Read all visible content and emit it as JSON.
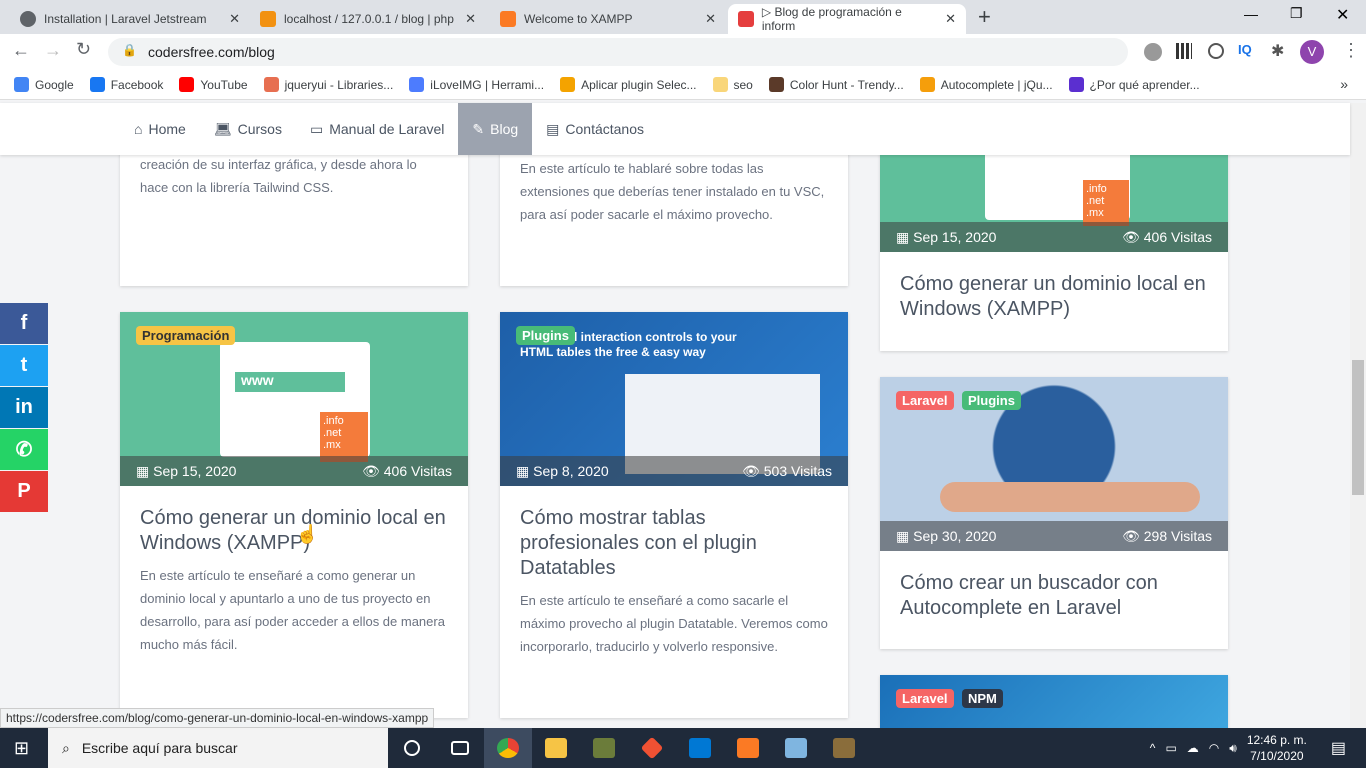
{
  "browser": {
    "tabs": [
      {
        "title": "Installation | Laravel Jetstream",
        "icon": "globe-icon",
        "color": "#5f6368"
      },
      {
        "title": "localhost / 127.0.0.1 / blog | php",
        "icon": "phpmyadmin-icon",
        "color": "#f29111"
      },
      {
        "title": "Welcome to XAMPP",
        "icon": "xampp-icon",
        "color": "#fb7a24"
      },
      {
        "title": "▷ Blog de programación e inform",
        "icon": "codersfree-icon",
        "color": "#e53e3e"
      }
    ],
    "new_tab": "+",
    "url": "codersfree.com/blog",
    "profile_initial": "V",
    "bookmarks": [
      {
        "label": "Google",
        "color": "#4285f4"
      },
      {
        "label": "Facebook",
        "color": "#1877f2"
      },
      {
        "label": "YouTube",
        "color": "#ff0000"
      },
      {
        "label": "jqueryui - Libraries...",
        "color": "#e76f51"
      },
      {
        "label": "iLoveIMG | Herrami...",
        "color": "#4d7cfe"
      },
      {
        "label": "Aplicar plugin Selec...",
        "color": "#f4a300"
      },
      {
        "label": "seo",
        "color": "#f9d67a"
      },
      {
        "label": "Color Hunt - Trendy...",
        "color": "#5b3a29"
      },
      {
        "label": "Autocomplete | jQu...",
        "color": "#f59e0b"
      },
      {
        "label": "¿Por qué aprender...",
        "color": "#5b2fd0"
      }
    ],
    "status_url": "https://codersfree.com/blog/como-generar-un-dominio-local-en-windows-xampp"
  },
  "nav": {
    "items": [
      {
        "label": "Home",
        "icon": "home-icon"
      },
      {
        "label": "Cursos",
        "icon": "laptop-icon"
      },
      {
        "label": "Manual de Laravel",
        "icon": "chalkboard-icon"
      },
      {
        "label": "Blog",
        "icon": "blog-icon",
        "active": true
      },
      {
        "label": "Contáctanos",
        "icon": "contact-card-icon"
      }
    ]
  },
  "share": [
    {
      "network": "facebook",
      "glyph": "f",
      "color": "#3b5998"
    },
    {
      "network": "twitter",
      "glyph": "t",
      "color": "#1da1f2"
    },
    {
      "network": "linkedin",
      "glyph": "in",
      "color": "#0077b5"
    },
    {
      "network": "whatsapp",
      "glyph": "✆",
      "color": "#25d366"
    },
    {
      "network": "pinterest",
      "glyph": "P",
      "color": "#e53935"
    }
  ],
  "posts": {
    "c1a": {
      "desc": "creación de su interfaz gráfica, y desde ahora lo hace con la librería Tailwind CSS."
    },
    "c2a": {
      "desc": "En este artículo te hablaré sobre todas las extensiones que deberías tener instalado en tu VSC, para así poder sacarle el máximo provecho."
    },
    "c3a": {
      "date": "Sep 15, 2020",
      "visits": "406 Visitas",
      "title": "Cómo generar un dominio local en Windows (XAMPP)"
    },
    "c1b": {
      "tags": [
        "Programación"
      ],
      "date": "Sep 15, 2020",
      "visits": "406 Visitas",
      "title": "Cómo generar un dominio local en Windows (XAMPP)",
      "desc": "En este artículo te enseñaré a como generar un dominio local y apuntarlo a uno de tus proyecto en desarrollo, para así poder acceder a ellos de manera mucho más fácil.",
      "image_text": "www"
    },
    "c2b": {
      "tags": [
        "Plugins"
      ],
      "date": "Sep 8, 2020",
      "visits": "503 Visitas",
      "title": "Cómo mostrar tablas profesionales con el plugin Datatables",
      "desc": "En este artículo te enseñaré a como sacarle el máximo provecho al plugin Datatable. Veremos como incorporarlo, traducirlo y volverlo responsive.",
      "image_text": "Advanced interaction controls to your HTML tables the free & easy way"
    },
    "c3b": {
      "tags": [
        "Laravel",
        "Plugins"
      ],
      "date": "Sep 30, 2020",
      "visits": "298 Visitas",
      "title": "Cómo crear un buscador con Autocomplete en Laravel"
    },
    "c3c": {
      "tags": [
        "Laravel",
        "NPM"
      ]
    }
  },
  "tag_colors": {
    "Programación": "#f6c445",
    "Plugins": "#48bb78",
    "Laravel": "#f56565",
    "NPM": "#2d3748"
  },
  "taskbar": {
    "search_placeholder": "Escribe aquí para buscar",
    "time": "12:46 p. m.",
    "date": "7/10/2020"
  }
}
